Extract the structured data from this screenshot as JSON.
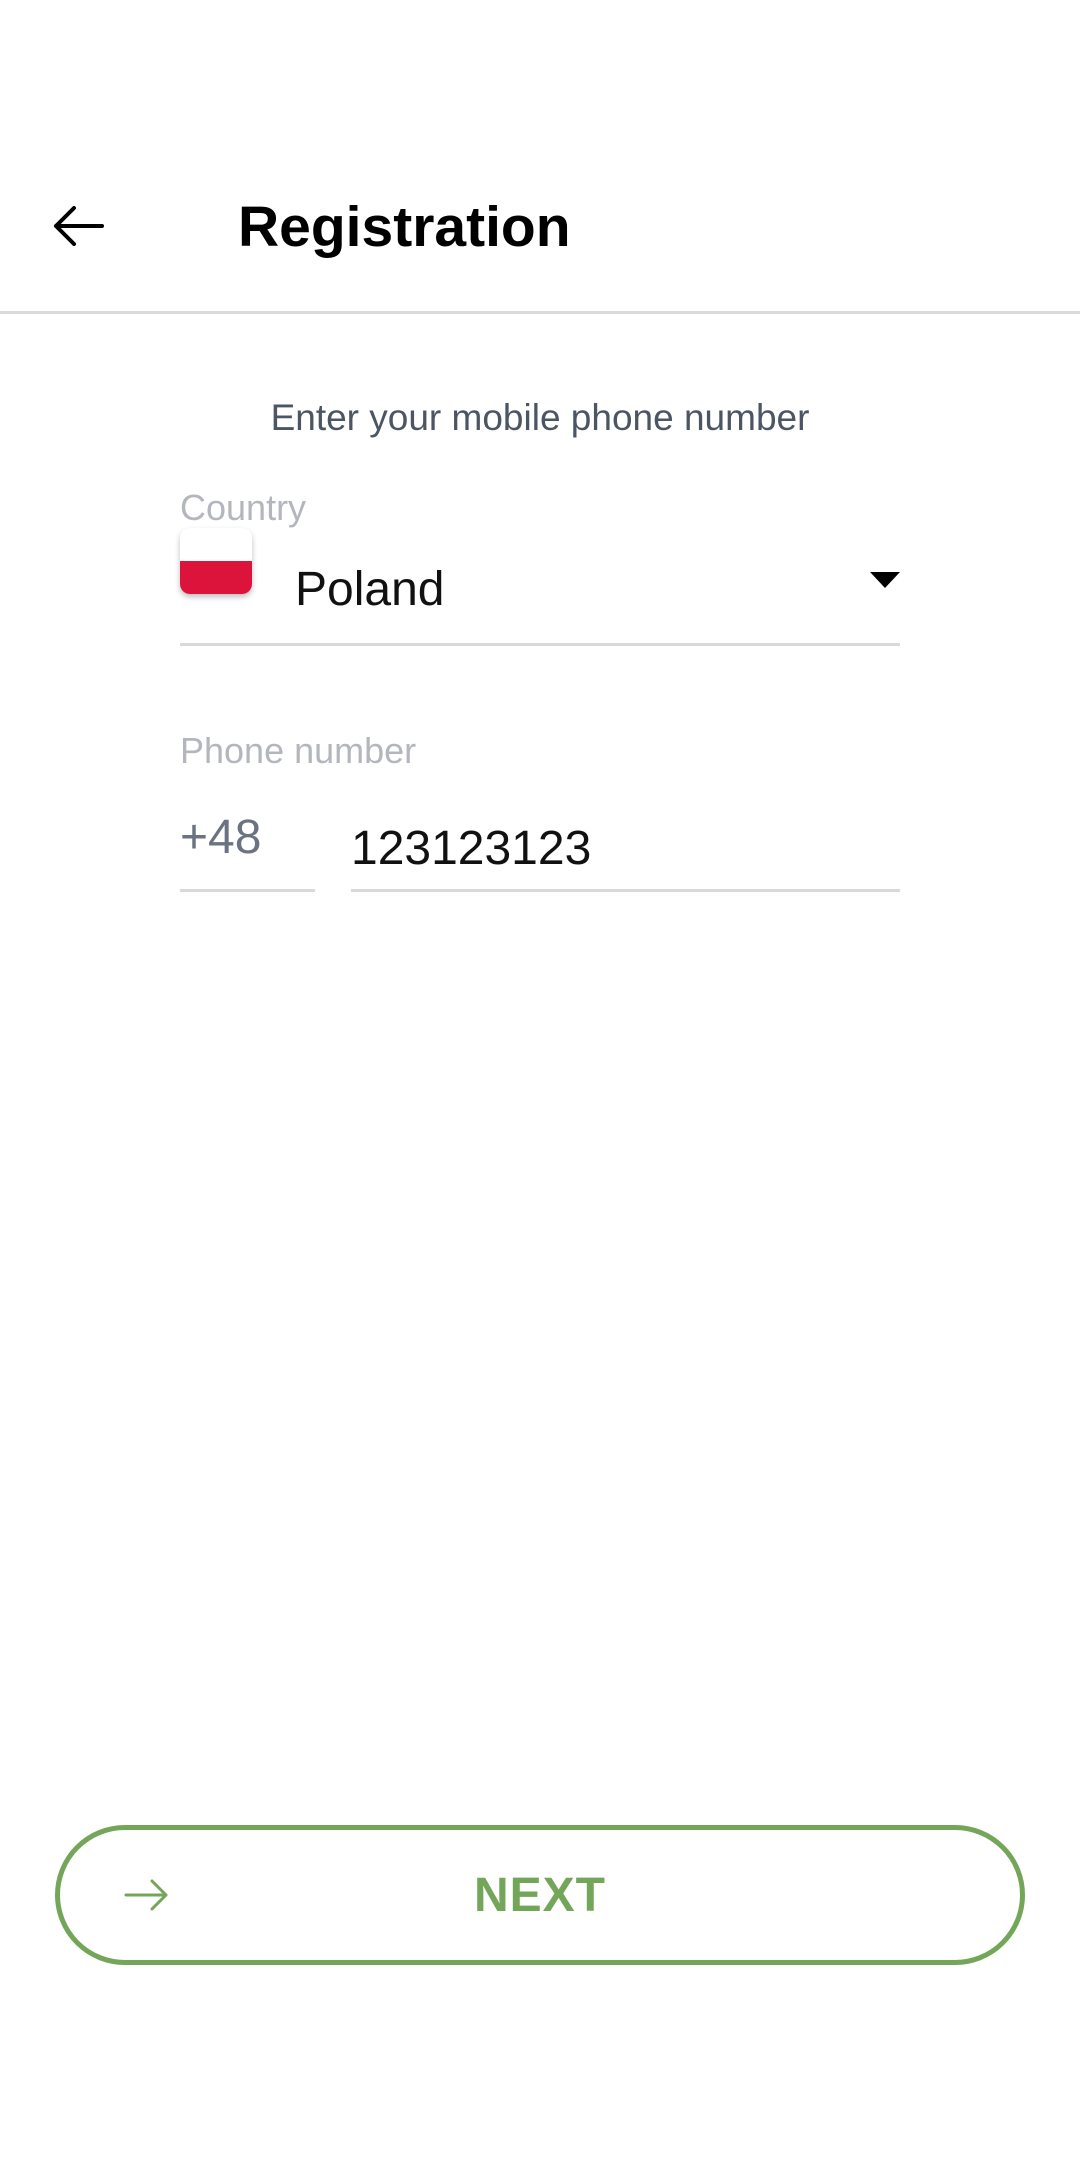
{
  "header": {
    "title": "Registration",
    "back_icon": "arrow-left-icon"
  },
  "form": {
    "instruction": "Enter your mobile phone number",
    "country": {
      "label": "Country",
      "value": "Poland",
      "flag": "poland-flag-icon",
      "dropdown_icon": "caret-down-icon"
    },
    "phone": {
      "label": "Phone number",
      "prefix": "+48",
      "value": "123123123"
    }
  },
  "actions": {
    "next_label": "NEXT",
    "next_icon": "arrow-right-icon",
    "accent_color": "#74a65a"
  }
}
